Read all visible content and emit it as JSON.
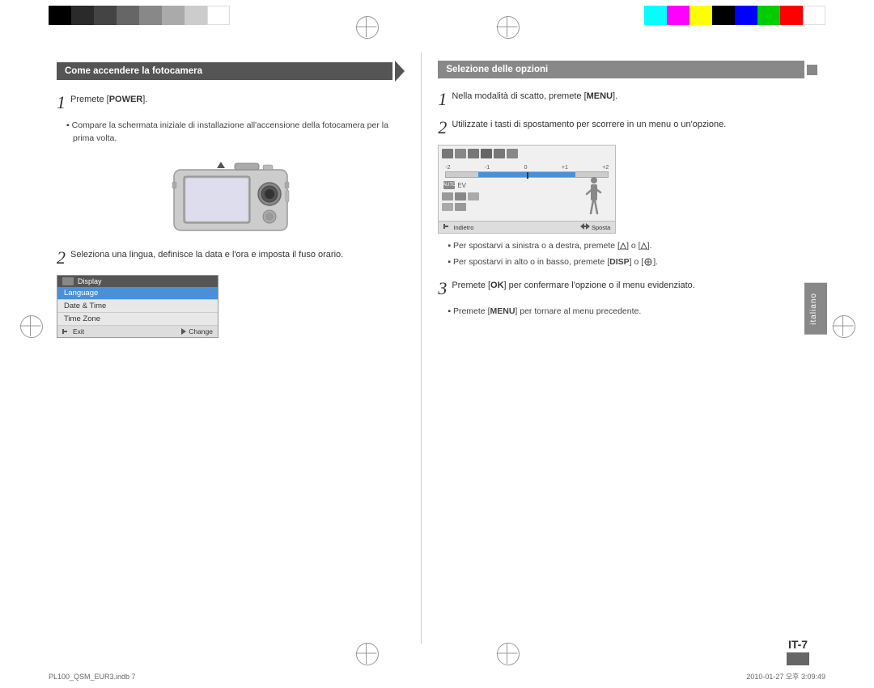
{
  "topBar": {
    "colorStripsLeft": [
      "black",
      "dark1",
      "dark2",
      "dark3",
      "gray1",
      "gray2",
      "gray3",
      "white"
    ],
    "colorStripsRight": [
      "cyan",
      "magenta",
      "yellow",
      "black",
      "blue",
      "green",
      "red",
      "white"
    ]
  },
  "leftSection": {
    "headerLabel": "Come accendere la fotocamera",
    "step1": {
      "number": "1",
      "text": "Premete [POWER].",
      "bullet": "Compare la schermata iniziale di installazione all'accensione della fotocamera per la prima volta."
    },
    "step2": {
      "number": "2",
      "text": "Seleziona una lingua, definisce la data e l'ora e imposta il fuso orario.",
      "menuItems": [
        "Language",
        "Date & Time",
        "Time Zone"
      ],
      "menuSelectedItem": "Language",
      "menuHeaderLabel": "Display",
      "menuFooterExit": "Exit",
      "menuFooterChange": "Change"
    }
  },
  "rightSection": {
    "headerLabel": "Selezione delle opzioni",
    "step1": {
      "number": "1",
      "text": "Nella modalità di scatto, premete [MENU]."
    },
    "step2": {
      "number": "2",
      "text": "Utilizzate i tasti di spostamento per scorrere in un menu o un'opzione.",
      "evLabel": "EV",
      "evValues": [
        "-2",
        "-1",
        "0",
        "+1",
        "+2"
      ],
      "menuFooterBack": "Indietro",
      "menuFooterMove": "Sposta",
      "bullet1": "Per spostarvi a sinistra o a destra, premete [",
      "bullet1mid": "] o [",
      "bullet1end": "].",
      "bullet2": "Per spostarvi in alto o in basso, premete [DISP] o [",
      "bullet2end": "]."
    },
    "step3": {
      "number": "3",
      "text": "Premete [OK] per confermare l'opzione o il menu evidenziato.",
      "bullet": "Premete [MENU] per tornare al menu precedente."
    }
  },
  "sidebar": {
    "label": "italiano"
  },
  "pageNumber": "IT-7",
  "footer": {
    "left": "PL100_QSM_EUR3.indb   7",
    "right": "2010-01-27   오후 3:09:49"
  }
}
